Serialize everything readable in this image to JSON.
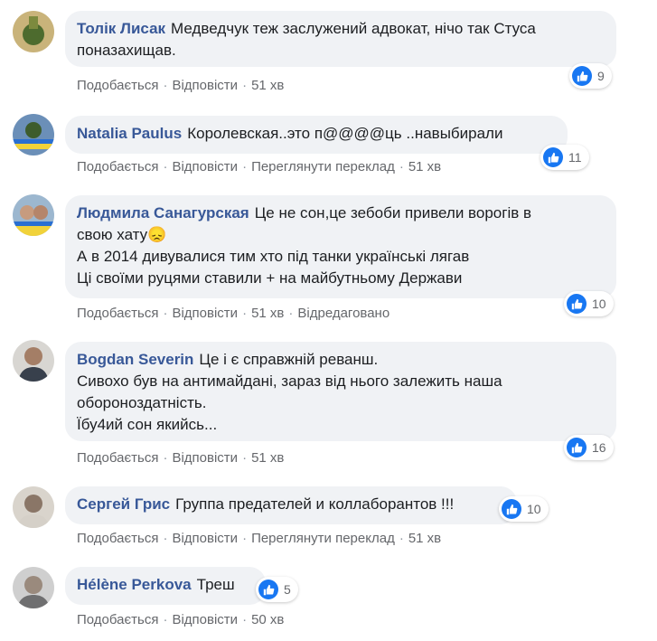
{
  "comments": [
    {
      "author": "Толік Лисак",
      "first": "Медведчук теж заслужений адвокат, нічо так Стуса",
      "lines": [
        "поназахищав."
      ],
      "likes": "9",
      "like_label": "Подобається",
      "reply_label": "Відповісти",
      "time": "51 хв"
    },
    {
      "author": "Natalia Paulus",
      "first": "Королевская..это п@@@@ць ..навыбирали",
      "lines": [],
      "likes": "11",
      "like_label": "Подобається",
      "reply_label": "Відповісти",
      "translate_label": "Переглянути переклад",
      "time": "51 хв"
    },
    {
      "author": "Людмила Санагурская",
      "first": "Це не сон,це зебоби привели ворогів в",
      "lines": [
        "свою хату😞",
        "А в 2014 дивувалися тим хто під танки українські лягав",
        "Ці своїми руцями ставили + на майбутньому Держави"
      ],
      "likes": "10",
      "like_label": "Подобається",
      "reply_label": "Відповісти",
      "time": "51 хв",
      "edited_label": "Відредаговано"
    },
    {
      "author": "Bogdan Severin",
      "first": "Це і є справжній реванш.",
      "lines": [
        "Сивохо був на антимайдані, зараз від нього залежить наша",
        "обороноздатність.",
        "Їбу4ий сон якийсь..."
      ],
      "likes": "16",
      "like_label": "Подобається",
      "reply_label": "Відповісти",
      "time": "51 хв"
    },
    {
      "author": "Сергей Грис",
      "first": "Группа предателей и коллаборантов !!!",
      "lines": [],
      "likes": "10",
      "like_label": "Подобається",
      "reply_label": "Відповісти",
      "translate_label": "Переглянути переклад",
      "time": "51 хв"
    },
    {
      "author": "Hélène Perkova",
      "first": "Треш",
      "lines": [],
      "likes": "5",
      "like_label": "Подобається",
      "reply_label": "Відповісти",
      "time": "50 хв"
    }
  ],
  "colors": {
    "author": "#385898",
    "bubble": "#f0f2f5",
    "like_blue": "#1877f2",
    "meta_gray": "#65676b"
  },
  "icons": {
    "like": "thumbs-up-icon",
    "separator": "·"
  }
}
